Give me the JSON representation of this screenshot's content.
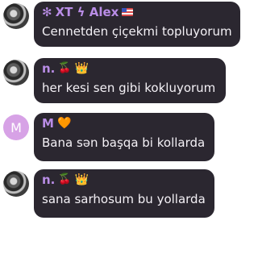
{
  "messages": [
    {
      "name": "XT ϟ Alex",
      "name_prefix_icon": "✻",
      "name_suffix_icon": "flag-icon",
      "text": "Cennetden çiçekmi topluyorum"
    },
    {
      "name": "n.",
      "name_icons": [
        "🍒",
        "👑"
      ],
      "text": "her kesi sen gibi kokluyorum"
    },
    {
      "name": "M",
      "avatar_letter": "M",
      "name_icons": [
        "🧡"
      ],
      "text": "Bana sən başqa bi kollarda"
    },
    {
      "name": "n.",
      "name_icons": [
        "🍒",
        "👑"
      ],
      "text": "sana sarhosum bu yollarda"
    }
  ]
}
